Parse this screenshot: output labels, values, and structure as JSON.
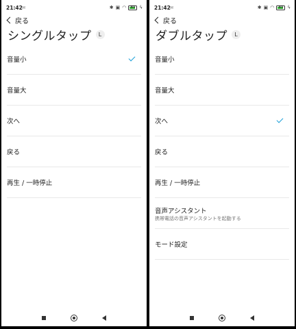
{
  "accent_color": "#1a9fd8",
  "screens": [
    {
      "status": {
        "time": "21:42",
        "battery": "83"
      },
      "back_label": "戻る",
      "title": "シングルタップ",
      "side_badge": "L",
      "options": [
        {
          "label": "音量小",
          "selected": true
        },
        {
          "label": "音量大",
          "selected": false
        },
        {
          "label": "次へ",
          "selected": false
        },
        {
          "label": "戻る",
          "selected": false
        },
        {
          "label": "再生 / 一時停止",
          "selected": false
        }
      ]
    },
    {
      "status": {
        "time": "21:42",
        "battery": "83"
      },
      "back_label": "戻る",
      "title": "ダブルタップ",
      "side_badge": "L",
      "options": [
        {
          "label": "音量小",
          "selected": false
        },
        {
          "label": "音量大",
          "selected": false
        },
        {
          "label": "次へ",
          "selected": true
        },
        {
          "label": "戻る",
          "selected": false
        },
        {
          "label": "再生 / 一時停止",
          "selected": false
        },
        {
          "label": "音声アシスタント",
          "subtitle": "携帯電話の音声アシスタントを起動する",
          "selected": false
        },
        {
          "label": "モード設定",
          "selected": false
        }
      ]
    }
  ]
}
